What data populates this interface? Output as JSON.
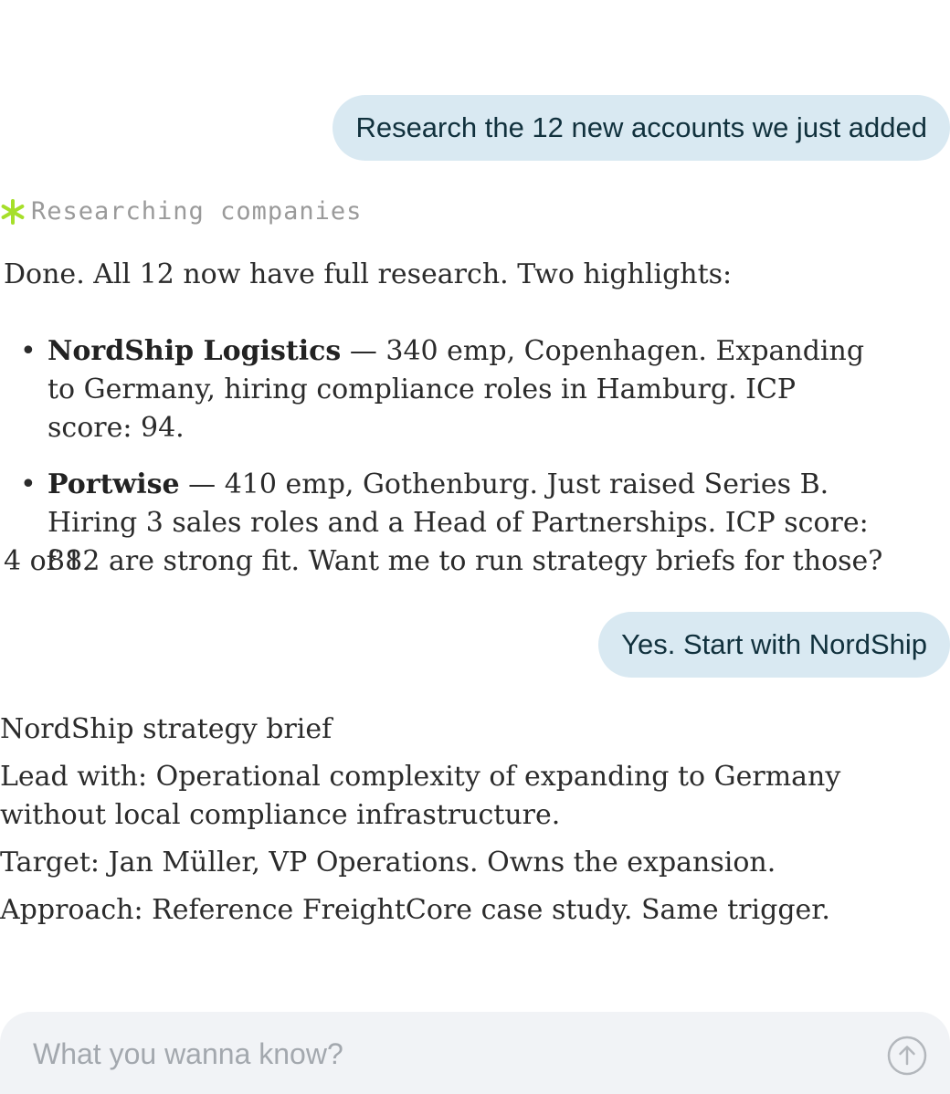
{
  "messages": {
    "user_1": "Research the 12 new accounts we just added",
    "status": "Researching companies",
    "reply_intro": "Done. All 12 now have full research. Two highlights:",
    "highlights": [
      {
        "name": "NordShip Logistics",
        "detail": " — 340 emp, Copenhagen. Expanding to Germany, hiring compliance roles in Hamburg. ICP score: 94."
      },
      {
        "name": "Portwise",
        "detail": " — 410 emp, Gothenburg. Just raised Series B. Hiring 3 sales roles and a Head of Partnerships. ICP score: 88."
      }
    ],
    "reply_outro": "4 of 12 are strong fit. Want me to run strategy briefs for those?",
    "user_2": "Yes. Start with NordShip",
    "brief": {
      "title": "NordShip strategy brief",
      "lead": "Lead with: Operational complexity of expanding to Germany without local compliance infrastructure.",
      "target": "Target: Jan Müller, VP Operations. Owns the expansion.",
      "approach": "Approach: Reference FreightCore case study. Same trigger."
    }
  },
  "composer": {
    "placeholder": "What you wanna know?",
    "send_icon": "arrow-up-circle-icon"
  },
  "colors": {
    "user_bubble": "#d9e9f2",
    "status_star": "#a6df2a",
    "composer_bg": "#f1f3f6"
  }
}
